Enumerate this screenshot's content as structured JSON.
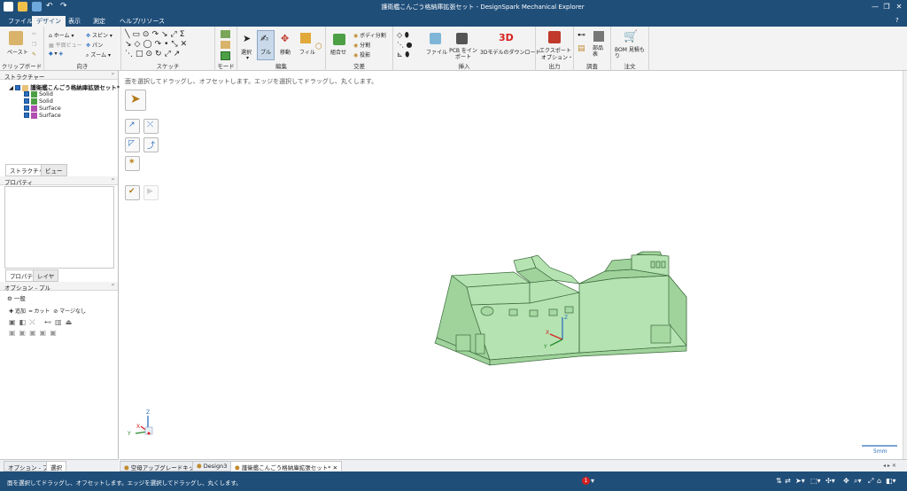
{
  "window": {
    "title": "護衛艦こんごう格納庫拡張セット - DesignSpark Mechanical Explorer",
    "minimize": "—",
    "restore": "❐",
    "close": "✕"
  },
  "menu": {
    "tabs": [
      {
        "label": "ファイル"
      },
      {
        "label": "デザイン"
      },
      {
        "label": "表示"
      },
      {
        "label": "測定"
      },
      {
        "label": "ヘルプ/リソース"
      }
    ],
    "help_icon": "?"
  },
  "ribbon": {
    "clipboard": {
      "paste": "ペースト",
      "group": "クリップボード"
    },
    "orient": {
      "home": "ホーム",
      "plane_view": "平面ビュー",
      "spin": "スピン",
      "pan": "パン",
      "zoom": "ズーム",
      "group": "向き"
    },
    "sketch": {
      "group": "スケッチ"
    },
    "mode": {
      "group": "モード"
    },
    "edit": {
      "select": "選択",
      "pull": "プル",
      "move": "移動",
      "fill": "フィル",
      "group": "編集"
    },
    "intersect": {
      "combine": "組合せ",
      "split_body": "ボディ分割",
      "split": "分割",
      "project": "投影",
      "group": "交差"
    },
    "insert": {
      "file": "ファイル",
      "pcb": "PCB をインポート",
      "model3d": "3Dモデルのダウンロード",
      "logo_3d": "3D",
      "group": "挿入"
    },
    "output": {
      "export": "エクスポート",
      "options": "オプション・",
      "group": "出力"
    },
    "investigate": {
      "parts": "部品表",
      "group": "調査"
    },
    "order": {
      "bom": "BOM 見積もり",
      "group": "注文"
    }
  },
  "structure": {
    "header": "ストラクチャー",
    "root": "護衛艦こんごう格納庫拡張セット*",
    "items": [
      {
        "label": "Solid"
      },
      {
        "label": "Solid"
      },
      {
        "label": "Surface"
      },
      {
        "label": "Surface"
      }
    ],
    "tabs": [
      "ストラクチャー",
      "ビュー"
    ]
  },
  "properties": {
    "header": "プロパティ",
    "tabs": [
      "プロパティ",
      "レイヤ"
    ]
  },
  "options": {
    "header": "オプション - プル",
    "general": "一般",
    "add": "追加",
    "cut": "カット",
    "no_merge": "マージなし"
  },
  "canvas": {
    "hint": "面を選択してドラッグし、オフセットします。エッジを選択してドラッグし、丸くします。",
    "scale": "5mm",
    "model_color": "#b5e3b2",
    "axis": {
      "x": "X",
      "y": "Y",
      "z": "Z"
    }
  },
  "doc_tabs": [
    {
      "label": "空母アップグレードキット"
    },
    {
      "label": "Design3"
    },
    {
      "label": "護衛艦こんごう格納庫拡張セット*"
    }
  ],
  "bottom_left_tabs": [
    "オプション - プル",
    "選択"
  ],
  "status": {
    "text": "面を選択してドラッグし、オフセットします。エッジを選択してドラッグし、丸くします。",
    "error_count": "1"
  }
}
